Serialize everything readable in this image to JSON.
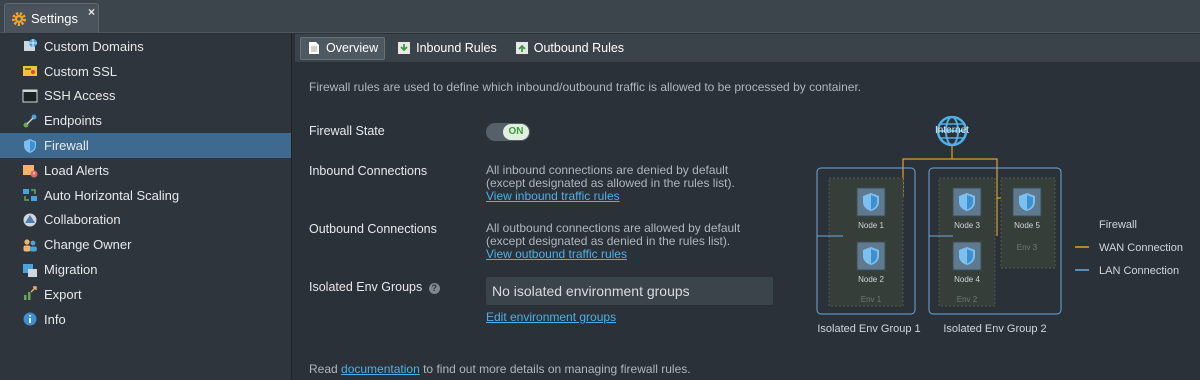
{
  "window": {
    "tab_title": "Settings",
    "close_glyph": "×"
  },
  "sidebar": {
    "items": [
      {
        "label": "Custom Domains",
        "icon": "globe-domain-icon"
      },
      {
        "label": "Custom SSL",
        "icon": "certificate-icon"
      },
      {
        "label": "SSH Access",
        "icon": "terminal-icon"
      },
      {
        "label": "Endpoints",
        "icon": "endpoints-icon"
      },
      {
        "label": "Firewall",
        "icon": "shield-icon",
        "active": true
      },
      {
        "label": "Load Alerts",
        "icon": "alert-icon"
      },
      {
        "label": "Auto Horizontal Scaling",
        "icon": "scaling-icon"
      },
      {
        "label": "Collaboration",
        "icon": "collaboration-icon"
      },
      {
        "label": "Change Owner",
        "icon": "users-icon"
      },
      {
        "label": "Migration",
        "icon": "migration-icon"
      },
      {
        "label": "Export",
        "icon": "export-icon"
      },
      {
        "label": "Info",
        "icon": "info-icon"
      }
    ]
  },
  "subtabs": [
    {
      "label": "Overview",
      "icon": "document-icon",
      "active": true
    },
    {
      "label": "Inbound Rules",
      "icon": "inbound-icon"
    },
    {
      "label": "Outbound Rules",
      "icon": "outbound-icon"
    }
  ],
  "intro": "Firewall rules are used to define which inbound/outbound traffic is allowed to be processed by container.",
  "firewall_state": {
    "label": "Firewall State",
    "toggle": "ON"
  },
  "inbound": {
    "label": "Inbound Connections",
    "line1": "All inbound connections are denied by default",
    "line2": "(except designated as allowed in the rules list).",
    "link": "View inbound traffic rules"
  },
  "outbound": {
    "label": "Outbound Connections",
    "line1": "All outbound connections are allowed by default",
    "line2": "(except designated as denied in the rules list).",
    "link": "View outbound traffic rules"
  },
  "isolated": {
    "label": "Isolated Env Groups",
    "help": "?",
    "value": "No isolated environment groups",
    "link": "Edit environment groups"
  },
  "footer": {
    "prefix": "Read ",
    "link": "documentation",
    "suffix": " to find out more details on managing firewall rules."
  },
  "diagram": {
    "internet": "Internet",
    "nodes": [
      "Node 1",
      "Node 2",
      "Node 3",
      "Node 4",
      "Node 5"
    ],
    "envs": [
      "Env 1",
      "Env 2",
      "Env 3"
    ],
    "groups": [
      "Isolated Env Group 1",
      "Isolated Env Group 2"
    ],
    "legend": {
      "title": "Firewall",
      "wan": "WAN Connection",
      "lan": "LAN Connection"
    },
    "colors": {
      "wan": "#e0a030",
      "lan": "#6fa8dc",
      "accent": "#4fb0e8"
    }
  },
  "colors": {
    "active_sidebar": "#3f6a90",
    "link": "#4fb0e8",
    "toggle_on": "#3f9a3f"
  }
}
